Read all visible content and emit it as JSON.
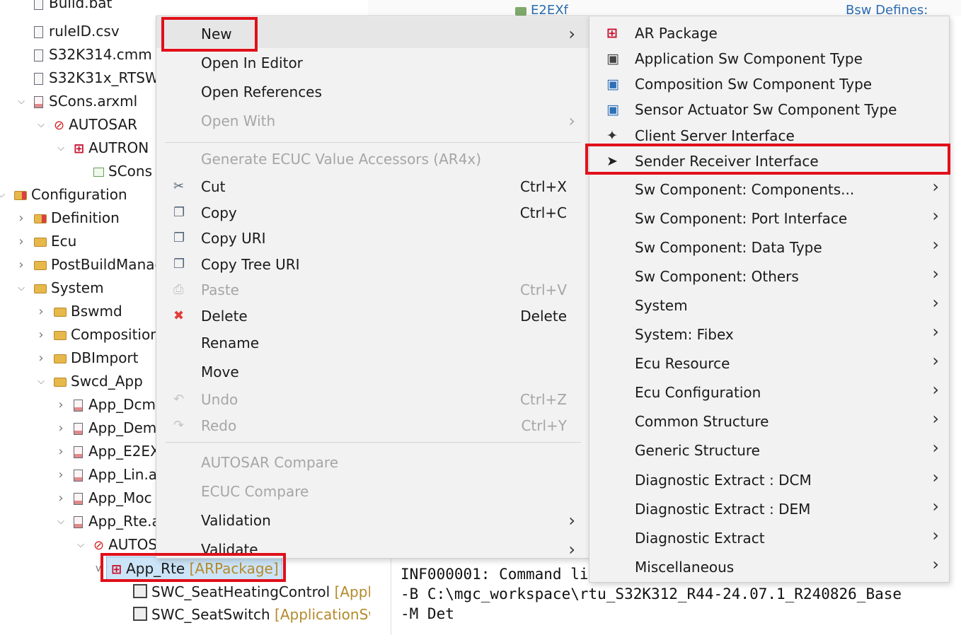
{
  "tree": {
    "rows": [
      {
        "label": "Build.bat",
        "indent": 1,
        "type": "file",
        "chevron": ""
      },
      {
        "label": "ruleID.csv",
        "indent": 1,
        "type": "file",
        "chevron": ""
      },
      {
        "label": "S32K314.cmm",
        "indent": 1,
        "type": "file",
        "chevron": ""
      },
      {
        "label": "S32K31x_RTSW",
        "indent": 1,
        "type": "file",
        "chevron": ""
      },
      {
        "label": "SCons.arxml",
        "indent": 1,
        "type": "arxml",
        "chevron": "v"
      },
      {
        "label": "AUTOSAR",
        "indent": 2,
        "type": "autosar",
        "chevron": "v"
      },
      {
        "label": "AUTRON",
        "indent": 3,
        "type": "package",
        "chevron": "v"
      },
      {
        "label": "SCons",
        "indent": 4,
        "type": "box",
        "chevron": ""
      },
      {
        "label": "Configuration",
        "indent": 0,
        "type": "folder-pkg",
        "chevron": "v"
      },
      {
        "label": "Definition",
        "indent": 1,
        "type": "folder-pkg",
        "chevron": ">"
      },
      {
        "label": "Ecu",
        "indent": 1,
        "type": "folder",
        "chevron": ">"
      },
      {
        "label": "PostBuildManag",
        "indent": 1,
        "type": "folder",
        "chevron": ">"
      },
      {
        "label": "System",
        "indent": 1,
        "type": "folder",
        "chevron": "v"
      },
      {
        "label": "Bswmd",
        "indent": 2,
        "type": "folder",
        "chevron": ">"
      },
      {
        "label": "Composition",
        "indent": 2,
        "type": "folder",
        "chevron": ">"
      },
      {
        "label": "DBImport",
        "indent": 2,
        "type": "folder",
        "chevron": ">"
      },
      {
        "label": "Swcd_App",
        "indent": 2,
        "type": "folder",
        "chevron": "v"
      },
      {
        "label": "App_Dcm",
        "indent": 3,
        "type": "arxml",
        "chevron": ">"
      },
      {
        "label": "App_Dem",
        "indent": 3,
        "type": "arxml",
        "chevron": ">"
      },
      {
        "label": "App_E2EX",
        "indent": 3,
        "type": "arxml",
        "chevron": ">"
      },
      {
        "label": "App_Lin.a",
        "indent": 3,
        "type": "arxml",
        "chevron": ">"
      },
      {
        "label": "App_Moc",
        "indent": 3,
        "type": "arxml",
        "chevron": ">"
      },
      {
        "label": "App_Rte.a",
        "indent": 3,
        "type": "arxml",
        "chevron": "v"
      },
      {
        "label": "AUTOS",
        "indent": 4,
        "type": "autosar",
        "chevron": "v"
      }
    ],
    "selected": {
      "label": "App_Rte",
      "suffix": "[ARPackage]"
    },
    "children": [
      {
        "label": "SWC_SeatHeatingControl",
        "suffix": "[Applic"
      },
      {
        "label": "SWC_SeatSwitch",
        "suffix": "[ApplicationSwC"
      }
    ]
  },
  "background": {
    "top_folder_label": "E2EXf",
    "top_right_label": "Bsw Defines:"
  },
  "context_menu": {
    "items": [
      {
        "label": "New",
        "shortcut": "",
        "submenu": true,
        "disabled": false,
        "icon": ""
      },
      {
        "label": "Open In Editor",
        "shortcut": "",
        "submenu": false,
        "disabled": false,
        "icon": ""
      },
      {
        "label": "Open References",
        "shortcut": "",
        "submenu": false,
        "disabled": false,
        "icon": ""
      },
      {
        "label": "Open With",
        "shortcut": "",
        "submenu": true,
        "disabled": true,
        "icon": ""
      },
      {
        "label": "Generate ECUC Value Accessors (AR4x)",
        "shortcut": "",
        "submenu": false,
        "disabled": true,
        "icon": ""
      },
      {
        "label": "Cut",
        "shortcut": "Ctrl+X",
        "submenu": false,
        "disabled": false,
        "icon": "scissors-icon"
      },
      {
        "label": "Copy",
        "shortcut": "Ctrl+C",
        "submenu": false,
        "disabled": false,
        "icon": "copy-icon"
      },
      {
        "label": "Copy URI",
        "shortcut": "",
        "submenu": false,
        "disabled": false,
        "icon": "copy-uri-icon"
      },
      {
        "label": "Copy Tree URI",
        "shortcut": "",
        "submenu": false,
        "disabled": false,
        "icon": "copy-tree-uri-icon"
      },
      {
        "label": "Paste",
        "shortcut": "Ctrl+V",
        "submenu": false,
        "disabled": true,
        "icon": "paste-icon"
      },
      {
        "label": "Delete",
        "shortcut": "Delete",
        "submenu": false,
        "disabled": false,
        "icon": "delete-icon"
      },
      {
        "label": "Rename",
        "shortcut": "",
        "submenu": false,
        "disabled": false,
        "icon": ""
      },
      {
        "label": "Move",
        "shortcut": "",
        "submenu": false,
        "disabled": false,
        "icon": ""
      },
      {
        "label": "Undo",
        "shortcut": "Ctrl+Z",
        "submenu": false,
        "disabled": true,
        "icon": "undo-icon"
      },
      {
        "label": "Redo",
        "shortcut": "Ctrl+Y",
        "submenu": false,
        "disabled": true,
        "icon": "redo-icon"
      },
      {
        "label": "AUTOSAR Compare",
        "shortcut": "",
        "submenu": false,
        "disabled": true,
        "icon": ""
      },
      {
        "label": "ECUC Compare",
        "shortcut": "",
        "submenu": false,
        "disabled": true,
        "icon": ""
      },
      {
        "label": "Validation",
        "shortcut": "",
        "submenu": true,
        "disabled": false,
        "icon": ""
      },
      {
        "label": "Validate",
        "shortcut": "",
        "submenu": true,
        "disabled": false,
        "icon": ""
      }
    ]
  },
  "submenu": {
    "items": [
      {
        "label": "AR Package",
        "submenu": false,
        "icon": "ar-package-icon"
      },
      {
        "label": "Application Sw Component Type",
        "submenu": false,
        "icon": "application-swc-icon"
      },
      {
        "label": "Composition Sw Component Type",
        "submenu": false,
        "icon": "composition-swc-icon"
      },
      {
        "label": "Sensor Actuator Sw Component Type",
        "submenu": false,
        "icon": "sensor-actuator-swc-icon"
      },
      {
        "label": "Client Server Interface",
        "submenu": false,
        "icon": "client-server-interface-icon"
      },
      {
        "label": "Sender Receiver Interface",
        "submenu": false,
        "icon": "sender-receiver-interface-icon"
      },
      {
        "label": "Sw Component: Components...",
        "submenu": true,
        "icon": ""
      },
      {
        "label": "Sw Component: Port Interface",
        "submenu": true,
        "icon": ""
      },
      {
        "label": "Sw Component: Data Type",
        "submenu": true,
        "icon": ""
      },
      {
        "label": "Sw Component: Others",
        "submenu": true,
        "icon": ""
      },
      {
        "label": "System",
        "submenu": true,
        "icon": ""
      },
      {
        "label": "System: Fibex",
        "submenu": true,
        "icon": ""
      },
      {
        "label": "Ecu Resource",
        "submenu": true,
        "icon": ""
      },
      {
        "label": "Ecu Configuration",
        "submenu": true,
        "icon": ""
      },
      {
        "label": "Common Structure",
        "submenu": true,
        "icon": ""
      },
      {
        "label": "Generic Structure",
        "submenu": true,
        "icon": ""
      },
      {
        "label": "Diagnostic Extract : DCM",
        "submenu": true,
        "icon": ""
      },
      {
        "label": "Diagnostic Extract : DEM",
        "submenu": true,
        "icon": ""
      },
      {
        "label": "Diagnostic Extract",
        "submenu": true,
        "icon": ""
      },
      {
        "label": "Miscellaneous",
        "submenu": true,
        "icon": ""
      }
    ]
  },
  "console": {
    "lines": [
      "INF000001: Command li",
      "-B C:\\mgc_workspace\\rtu_S32K312_R44-24.07.1_R240826_Base",
      "-M Det"
    ]
  },
  "colors": {
    "highlight": "#e0101a",
    "menu_bg": "#f2f2f2",
    "disabled": "#a6a6a6",
    "package_red": "#c8102e",
    "folder": "#e7b84a"
  }
}
